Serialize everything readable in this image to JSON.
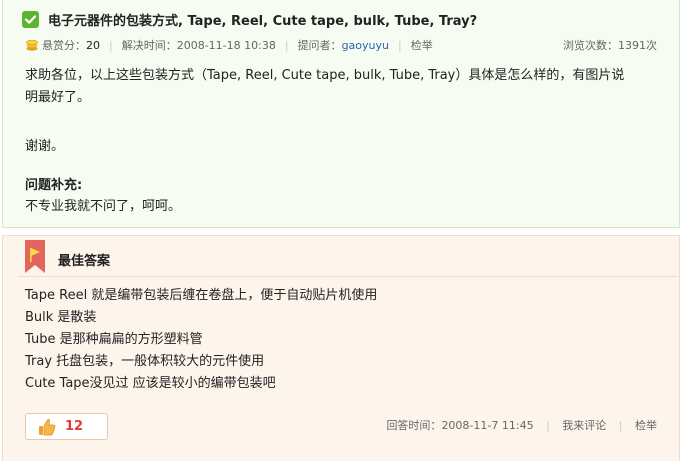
{
  "question": {
    "title": "电子元器件的包装方式, Tape, Reel, Cute tape, bulk, Tube, Tray?",
    "meta": {
      "reward_label": "悬赏分：",
      "reward_value": "20",
      "solved_label": "解决时间：",
      "solved_time": "2008-11-18 10:38",
      "asker_label": "提问者：",
      "asker": "gaoyuyu",
      "report": "检举",
      "views_label": "浏览次数：",
      "views": "1391次"
    },
    "body_line1": "求助各位，以上这些包装方式（Tape, Reel, Cute tape, bulk, Tube, Tray）具体是怎么样的，有图片说",
    "body_line2": "明最好了。",
    "body_thanks": "谢谢。",
    "supplement_title": "问题补充:",
    "supplement_text": "不专业我就不问了，呵呵。"
  },
  "answer": {
    "title": "最佳答案",
    "lines": [
      "Tape Reel 就是编带包装后缠在卷盘上，便于自动贴片机使用",
      "Bulk 是散装",
      "Tube 是那种扁扁的方形塑料管",
      "Tray 托盘包装，一般体积较大的元件使用",
      "Cute Tape没见过 应该是较小的编带包装吧"
    ],
    "like_count": "12",
    "meta": {
      "answer_time_label": "回答时间：",
      "answer_time": "2008-11-7 11:45",
      "comment": "我来评论",
      "report": "检举"
    }
  },
  "icons": {
    "check": "check-icon",
    "coin": "coin-icon",
    "ribbon": "ribbon-icon",
    "thumb": "thumbs-up-icon"
  },
  "colors": {
    "check_green": "#5cb531",
    "link_blue": "#2d64b3",
    "like_red": "#e4392f",
    "question_bg": "#f6fcf2",
    "answer_bg": "#fdf4ec"
  }
}
